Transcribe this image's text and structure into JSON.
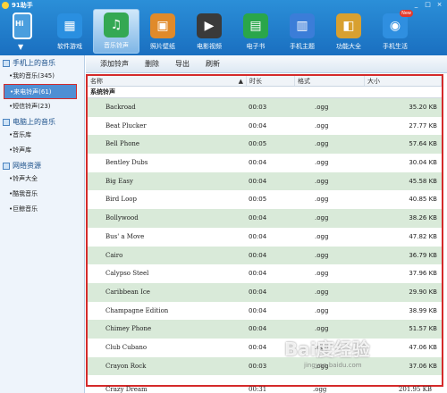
{
  "app": {
    "title": "91助手",
    "win_controls": [
      "_",
      "□",
      "×"
    ]
  },
  "nav": [
    {
      "label": "软件游戏",
      "icon": "apps-icon",
      "color": "#2a8fe0",
      "glyph": "▦"
    },
    {
      "label": "音乐铃声",
      "icon": "music-icon",
      "color": "#34a853",
      "glyph": "♫",
      "active": true
    },
    {
      "label": "照片壁纸",
      "icon": "photo-icon",
      "color": "#e08a2a",
      "glyph": "▣"
    },
    {
      "label": "电影视频",
      "icon": "film-icon",
      "color": "#3a3a3a",
      "glyph": "▶"
    },
    {
      "label": "电子书",
      "icon": "book-icon",
      "color": "#2aa64a",
      "glyph": "▤"
    },
    {
      "label": "手机主题",
      "icon": "theme-icon",
      "color": "#3b7dd8",
      "glyph": "▥"
    },
    {
      "label": "功能大全",
      "icon": "toolbox-icon",
      "color": "#d8a030",
      "glyph": "◧"
    },
    {
      "label": "手机生活",
      "icon": "life-icon",
      "color": "#2f8fe0",
      "glyph": "◉",
      "badge": "New"
    }
  ],
  "device": {
    "label": "Hi"
  },
  "sidebar": {
    "sections": [
      {
        "title": "手机上的音乐",
        "items": [
          "我的音乐(345)",
          "来电铃声(61)",
          "短信铃声(23)"
        ]
      },
      {
        "title": "电脑上的音乐",
        "items": [
          "音乐库",
          "铃声库"
        ]
      },
      {
        "title": "网络资源",
        "items": [
          "铃声大全",
          "酷我音乐",
          "巨鲸音乐"
        ]
      }
    ]
  },
  "toolbar": {
    "add": "添加铃声",
    "delete": "删除",
    "export": "导出",
    "refresh": "刷新"
  },
  "table": {
    "headers": {
      "name": "名称",
      "duration": "时长",
      "format": "格式",
      "size": "大小"
    },
    "group": "系统铃声",
    "rows": [
      {
        "name": "Backroad",
        "duration": "00:03",
        "format": ".ogg",
        "size": "35.20 KB"
      },
      {
        "name": "Beat Plucker",
        "duration": "00:04",
        "format": ".ogg",
        "size": "27.77 KB"
      },
      {
        "name": "Bell Phone",
        "duration": "00:05",
        "format": ".ogg",
        "size": "57.64 KB"
      },
      {
        "name": "Bentley Dubs",
        "duration": "00:04",
        "format": ".ogg",
        "size": "30.04 KB"
      },
      {
        "name": "Big Easy",
        "duration": "00:04",
        "format": ".ogg",
        "size": "45.58 KB"
      },
      {
        "name": "Bird Loop",
        "duration": "00:05",
        "format": ".ogg",
        "size": "40.85 KB"
      },
      {
        "name": "Bollywood",
        "duration": "00:04",
        "format": ".ogg",
        "size": "38.26 KB"
      },
      {
        "name": "Bus' a Move",
        "duration": "00:04",
        "format": ".ogg",
        "size": "47.82 KB"
      },
      {
        "name": "Cairo",
        "duration": "00:04",
        "format": ".ogg",
        "size": "36.79 KB"
      },
      {
        "name": "Calypso Steel",
        "duration": "00:04",
        "format": ".ogg",
        "size": "37.96 KB"
      },
      {
        "name": "Caribbean Ice",
        "duration": "00:04",
        "format": ".ogg",
        "size": "29.90 KB"
      },
      {
        "name": "Champagne Edition",
        "duration": "00:04",
        "format": ".ogg",
        "size": "38.99 KB"
      },
      {
        "name": "Chimey Phone",
        "duration": "00:04",
        "format": ".ogg",
        "size": "51.57 KB"
      },
      {
        "name": "Club Cubano",
        "duration": "00:04",
        "format": ".ogg",
        "size": "47.06 KB"
      },
      {
        "name": "Crayon Rock",
        "duration": "00:03",
        "format": ".ogg",
        "size": "37.06 KB"
      }
    ],
    "last_row": {
      "name": "Crazy Dream",
      "duration": "00:31",
      "format": ".ogg",
      "size": "201.95 KB"
    }
  },
  "watermark": {
    "text": "Bai度经验",
    "url": "jingyan.baidu.com"
  }
}
